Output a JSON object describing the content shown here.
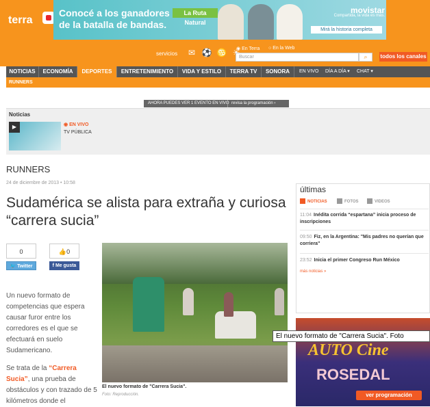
{
  "header": {
    "logo": "terra",
    "banner": {
      "headline": "Conocé a los ganadores de la batalla de bandas.",
      "brand_tag": "La Ruta Natural",
      "sponsor": "movistar",
      "sponsor_tagline": "Compartida, la vida es más.",
      "cta": "Mirá la historia completa"
    },
    "tools": {
      "servicios": "servicios",
      "radio_terra": "En Terra",
      "radio_web": "En la Web",
      "search_placeholder": "Buscar",
      "todos_canales": "todos los canales"
    }
  },
  "nav": {
    "items": [
      "NOTICIAS",
      "ECONOMÍA",
      "DEPORTES",
      "ENTRETENIMIENTO",
      "VIDA Y ESTILO",
      "TERRA TV",
      "SONORA"
    ],
    "en_vivo": "EN VIVO",
    "dia_a_dia": "DÍA A DÍA",
    "chat": "CHAT",
    "sub": "RUNNERS"
  },
  "live_bar": {
    "text": "AHORA PUEDES VER 1 EVENTO EN VIVO",
    "link": "revisa la programación"
  },
  "noticias_box": {
    "title": "Noticias",
    "status": "EN VIVO",
    "channel": "TV PÚBLICA"
  },
  "article": {
    "section": "RUNNERS",
    "date": "24 de diciembre de 2013 • 10:58",
    "headline": "Sudamérica se alista para extraña y curiosa “carrera sucia”",
    "twitter_count": "0",
    "twitter_label": "Twitter",
    "facebook_count": "0",
    "facebook_label": "Me gusta",
    "p1": "Un nuevo formato de competencias que espera causar furor entre los corredores es el que se efectuará en suelo Sudamericano.",
    "p2_pre": "Se trata de la ",
    "p2_bold": "“Carrera Sucia”",
    "p2_post": ", una prueba de obstáculos y con trazado de 5 kilómetros donde el",
    "caption": "El nuevo formato de \"Carrera Sucia\".",
    "credit": "Foto: Reproducción."
  },
  "sidebar": {
    "title": "últimas",
    "tabs": [
      "NOTICIAS",
      "FOTOS",
      "VIDEOS"
    ],
    "news": [
      {
        "time": "11:04",
        "text": "Inédita corrida “espartana” inicia proceso de inscripciones"
      },
      {
        "time": "09:50",
        "text": "Fiz, en la Argentina: \"Mis padres no querían que corriera\""
      },
      {
        "time": "23:52",
        "text": "Inicia el primer Congreso Run México"
      }
    ],
    "more": "más noticias »"
  },
  "ad": {
    "line1": "AUTO Cine",
    "line2": "ROSEDAL",
    "cta": "ver programación"
  },
  "tooltip": "El  nuevo formato de \"Carrera Sucia\". Foto"
}
